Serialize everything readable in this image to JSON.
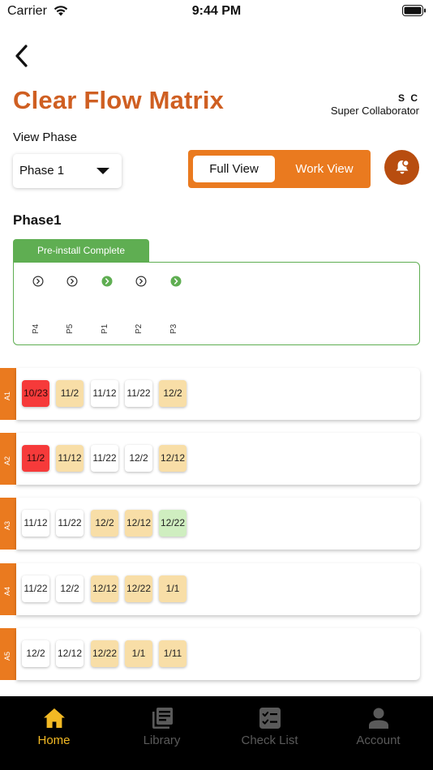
{
  "status_bar": {
    "carrier": "Carrier",
    "time": "9:44 PM"
  },
  "header": {
    "title": "Clear Flow Matrix",
    "user_initials": "S C",
    "user_role": "Super Collaborator"
  },
  "view_phase": {
    "label": "View Phase",
    "selected": "Phase 1"
  },
  "view_toggle": {
    "full_label": "Full View",
    "work_label": "Work View",
    "active": "Full View"
  },
  "phase": {
    "heading": "Phase1",
    "status_tab": "Pre-install Complete",
    "columns": [
      {
        "label": "P4",
        "status": "pending"
      },
      {
        "label": "P5",
        "status": "pending"
      },
      {
        "label": "P1",
        "status": "complete"
      },
      {
        "label": "P2",
        "status": "pending"
      },
      {
        "label": "P3",
        "status": "complete"
      }
    ]
  },
  "rows": [
    {
      "label": "A1",
      "chips": [
        {
          "text": "10/23",
          "color": "red"
        },
        {
          "text": "11/2",
          "color": "yellow"
        },
        {
          "text": "11/12",
          "color": "white"
        },
        {
          "text": "11/22",
          "color": "white"
        },
        {
          "text": "12/2",
          "color": "yellow"
        }
      ]
    },
    {
      "label": "A2",
      "chips": [
        {
          "text": "11/2",
          "color": "red"
        },
        {
          "text": "11/12",
          "color": "yellow"
        },
        {
          "text": "11/22",
          "color": "white"
        },
        {
          "text": "12/2",
          "color": "white"
        },
        {
          "text": "12/12",
          "color": "yellow"
        }
      ]
    },
    {
      "label": "A3",
      "chips": [
        {
          "text": "11/12",
          "color": "white"
        },
        {
          "text": "11/22",
          "color": "white"
        },
        {
          "text": "12/2",
          "color": "yellow"
        },
        {
          "text": "12/12",
          "color": "yellow"
        },
        {
          "text": "12/22",
          "color": "green"
        }
      ]
    },
    {
      "label": "A4",
      "chips": [
        {
          "text": "11/22",
          "color": "white"
        },
        {
          "text": "12/2",
          "color": "white"
        },
        {
          "text": "12/12",
          "color": "yellow"
        },
        {
          "text": "12/22",
          "color": "yellow"
        },
        {
          "text": "1/1",
          "color": "yellow"
        }
      ]
    },
    {
      "label": "A5",
      "chips": [
        {
          "text": "12/2",
          "color": "white"
        },
        {
          "text": "12/12",
          "color": "white"
        },
        {
          "text": "12/22",
          "color": "yellow"
        },
        {
          "text": "1/1",
          "color": "yellow"
        },
        {
          "text": "1/11",
          "color": "yellow"
        }
      ]
    }
  ],
  "bottom_nav": [
    {
      "label": "Home",
      "icon": "home-icon",
      "active": true
    },
    {
      "label": "Library",
      "icon": "library-icon",
      "active": false
    },
    {
      "label": "Check List",
      "icon": "checklist-icon",
      "active": false
    },
    {
      "label": "Account",
      "icon": "account-icon",
      "active": false
    }
  ],
  "colors": {
    "accent": "#ea7a1f",
    "title": "#cf5f22",
    "complete_green": "#5fae52",
    "chip_red": "#f63a3a",
    "chip_yellow": "#f8dea7",
    "chip_green": "#cfeec0",
    "nav_active": "#f2b924"
  }
}
